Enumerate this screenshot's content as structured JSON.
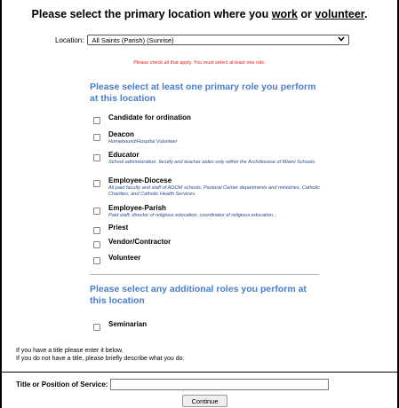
{
  "heading": {
    "prefix": "Please select the primary location where you ",
    "work": "work",
    "middle": " or ",
    "volunteer": "volunteer",
    "suffix": "."
  },
  "location": {
    "label": "Location:",
    "selected": "All Saints (Parish) (Sunrise)",
    "chevron_icon": "chevron-down-icon"
  },
  "warning": "Please check all that apply. You must select at least one role.",
  "primary_section": {
    "title": "Please select at least one primary role you perform at this location",
    "roles": [
      {
        "label": "Candidate for ordination",
        "desc": ""
      },
      {
        "label": "Deacon",
        "desc": "Homebound/Hospital Volunteer"
      },
      {
        "label": "Educator",
        "desc": "School administration, faculty and teacher aides only within the Archdiocese of Miami Schools."
      },
      {
        "label": "Employee-Diocese",
        "desc": "All paid faculty and staff of ADOM schools, Pastoral Center departments and ministries, Catholic Charities, and Catholic Health Services."
      },
      {
        "label": "Employee-Parish",
        "desc": "Paid staff, director of religious education, coordinator of religious education."
      },
      {
        "label": "Priest",
        "desc": ""
      },
      {
        "label": "Vendor/Contractor",
        "desc": ""
      },
      {
        "label": "Volunteer",
        "desc": ""
      }
    ]
  },
  "additional_section": {
    "title": "Please select any additional roles you perform at this location",
    "roles": [
      {
        "label": "Seminarian",
        "desc": ""
      }
    ]
  },
  "info": {
    "line1": "If you have a title please enter it below.",
    "line2": "If you do not have a title, please briefly describe what you do."
  },
  "title_field": {
    "label": "Title or Position of Service:",
    "value": ""
  },
  "continue_label": "Continue",
  "colors": {
    "section_title": "#4a7ec8",
    "warning": "#e0201a",
    "desc": "#2a4a8a"
  }
}
